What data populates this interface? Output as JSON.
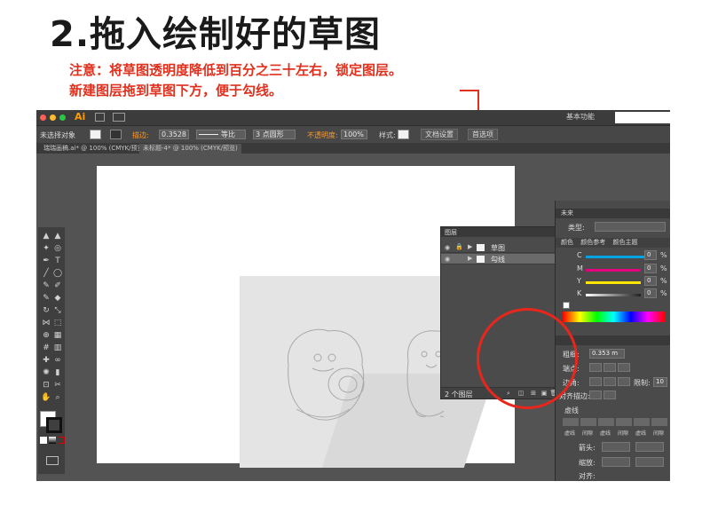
{
  "heading": "2.拖入绘制好的草图",
  "instructions": {
    "line1": "注意：将草图透明度降低到百分之三十左右，锁定图层。",
    "line2": "新建图层拖到草图下方，便于勾线。"
  },
  "app": {
    "logo": "Ai",
    "workspace": "基本功能",
    "control": {
      "selection": "未选择对象",
      "stroke_label": "描边:",
      "stroke_value": "0.3528",
      "profile": "等比",
      "brush": "3 点圆形",
      "opacity_label": "不透明度:",
      "opacity_value": "100%",
      "style_label": "样式:",
      "doc_setup": "文档设置",
      "preferences": "首选项"
    },
    "tabs": [
      "瑞瑞画稿.ai* @ 100% (CMYK/预览)",
      "未标题-4* @ 100% (CMYK/预览)"
    ],
    "layers_panel": {
      "title": "图层",
      "layers": [
        {
          "name": "草图",
          "selected": false
        },
        {
          "name": "勾线",
          "selected": true
        }
      ],
      "footer": "2 个图层"
    },
    "right_dock": {
      "brush_title": "未来",
      "type_label": "类型:",
      "color_tab": "颜色",
      "color_guide_tab": "颜色参考",
      "color_theme_tab": "颜色主题",
      "cmyk": [
        {
          "channel": "C",
          "value": "0",
          "color": "#00a4e4"
        },
        {
          "channel": "M",
          "value": "0",
          "color": "#e6007e"
        },
        {
          "channel": "Y",
          "value": "0",
          "color": "#ffe600"
        },
        {
          "channel": "K",
          "value": "0",
          "color": "#222222"
        }
      ],
      "percent": "%",
      "stroke_weight_label": "粗细:",
      "stroke_weight_value": "0.353 m",
      "cap_label": "端点:",
      "corner_label": "边角:",
      "limit_label": "限制:",
      "limit_value": "10",
      "align_label": "对齐描边:",
      "dashed_label": "虚线",
      "dash_labels": [
        "虚线",
        "间隙",
        "虚线",
        "间隙",
        "虚线",
        "间隙"
      ],
      "arrow_label": "箭头:",
      "scale_label": "缩放:",
      "align_arrow_label": "对齐:"
    }
  }
}
